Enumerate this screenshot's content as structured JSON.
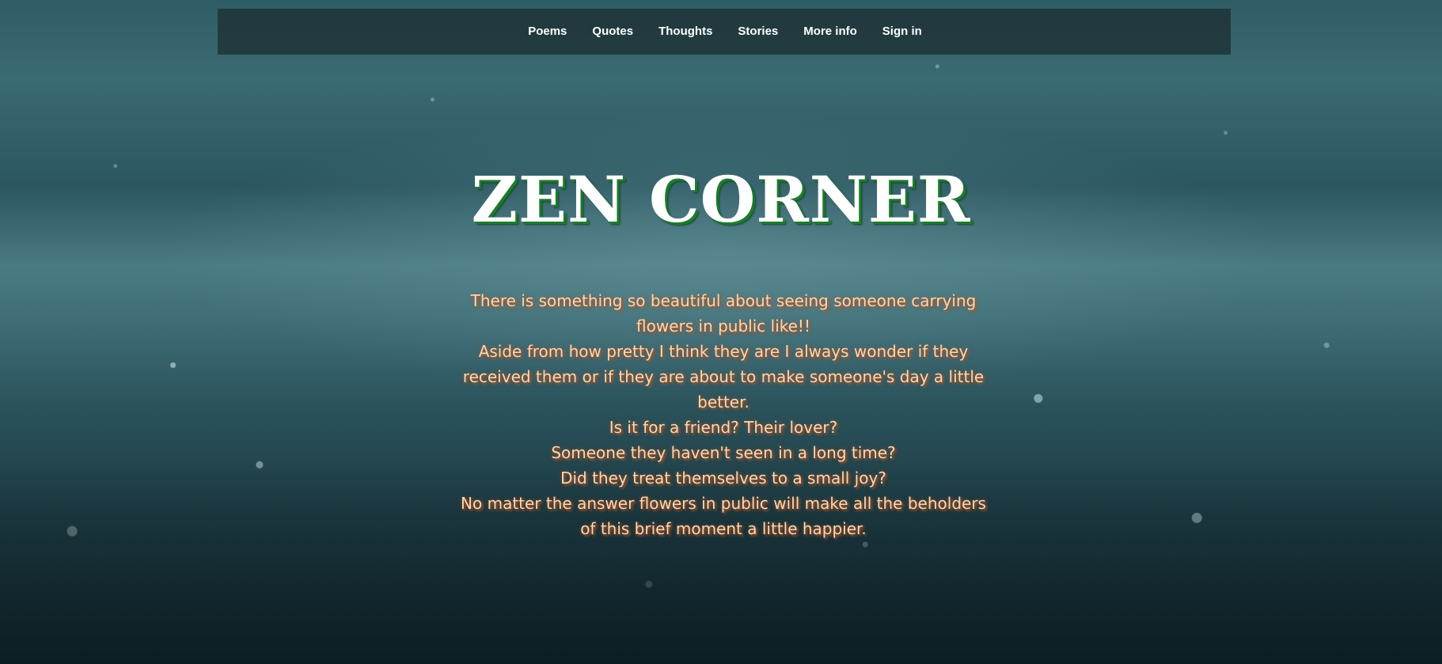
{
  "nav": {
    "items": [
      {
        "label": "Poems"
      },
      {
        "label": "Quotes"
      },
      {
        "label": "Thoughts"
      },
      {
        "label": "Stories"
      },
      {
        "label": "More info"
      },
      {
        "label": "Sign in"
      }
    ]
  },
  "hero": {
    "title": "ZEN CORNER",
    "lines": [
      "There is something so beautiful about seeing someone carrying flowers in public like!!",
      "Aside from how pretty I think they are I always wonder if they received them or if they are about to make someone's day a little better.",
      "Is it for a friend? Their lover?",
      "Someone they haven't seen in a long time?",
      "Did they treat themselves to a small joy?",
      "No matter the answer flowers in public will make all the beholders of this brief moment a little happier."
    ]
  },
  "colors": {
    "title_shadow": "#1e7a2e",
    "text": "#f3d9b8",
    "text_shadow": "#b5521f",
    "navbar_bg": "#1e3236"
  }
}
